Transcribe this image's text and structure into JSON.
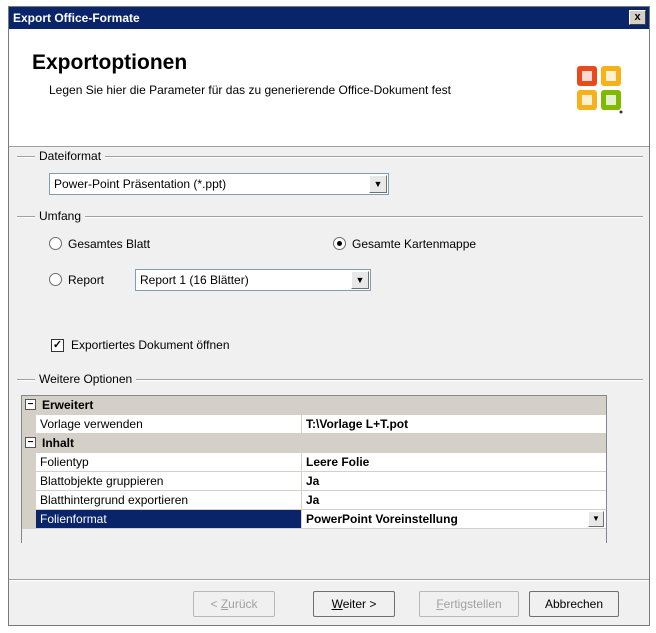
{
  "window": {
    "title": "Export Office-Formate",
    "close_label": "x"
  },
  "header": {
    "title": "Exportoptionen",
    "description": "Legen Sie hier die Parameter für das zu generierende Office-Dokument fest",
    "logo": "office-logo-icon"
  },
  "dateiformat": {
    "label": "Dateiformat",
    "selected": "Power-Point Präsentation (*.ppt)"
  },
  "umfang": {
    "label": "Umfang",
    "option_sheet": "Gesamtes Blatt",
    "option_workbook": "Gesamte Kartenmappe",
    "option_report": "Report",
    "report_selected": "Report 1 (16 Blätter)",
    "selected_option": "Gesamte Kartenmappe"
  },
  "open_document": {
    "label": "Exportiertes Dokument öffnen",
    "checked": true
  },
  "weitere": {
    "label": "Weitere Optionen",
    "categories": [
      {
        "name": "Erweitert",
        "properties": [
          {
            "name": "Vorlage verwenden",
            "value": "T:\\Vorlage L+T.pot"
          }
        ]
      },
      {
        "name": "Inhalt",
        "properties": [
          {
            "name": "Folientyp",
            "value": "Leere Folie"
          },
          {
            "name": "Blattobjekte gruppieren",
            "value": "Ja"
          },
          {
            "name": "Blatthintergrund exportieren",
            "value": "Ja"
          },
          {
            "name": "Folienformat",
            "value": "PowerPoint Voreinstellung"
          }
        ]
      }
    ]
  },
  "buttons": {
    "back": {
      "prefix": "< ",
      "mnemonic": "Z",
      "rest": "urück"
    },
    "next": {
      "mnemonic": "W",
      "rest": "eiter >"
    },
    "finish": {
      "mnemonic": "F",
      "rest": "ertigstellen"
    },
    "cancel": "Abbrechen"
  },
  "colors": {
    "titlebar": "#0a246a",
    "selection": "#0a246a"
  }
}
